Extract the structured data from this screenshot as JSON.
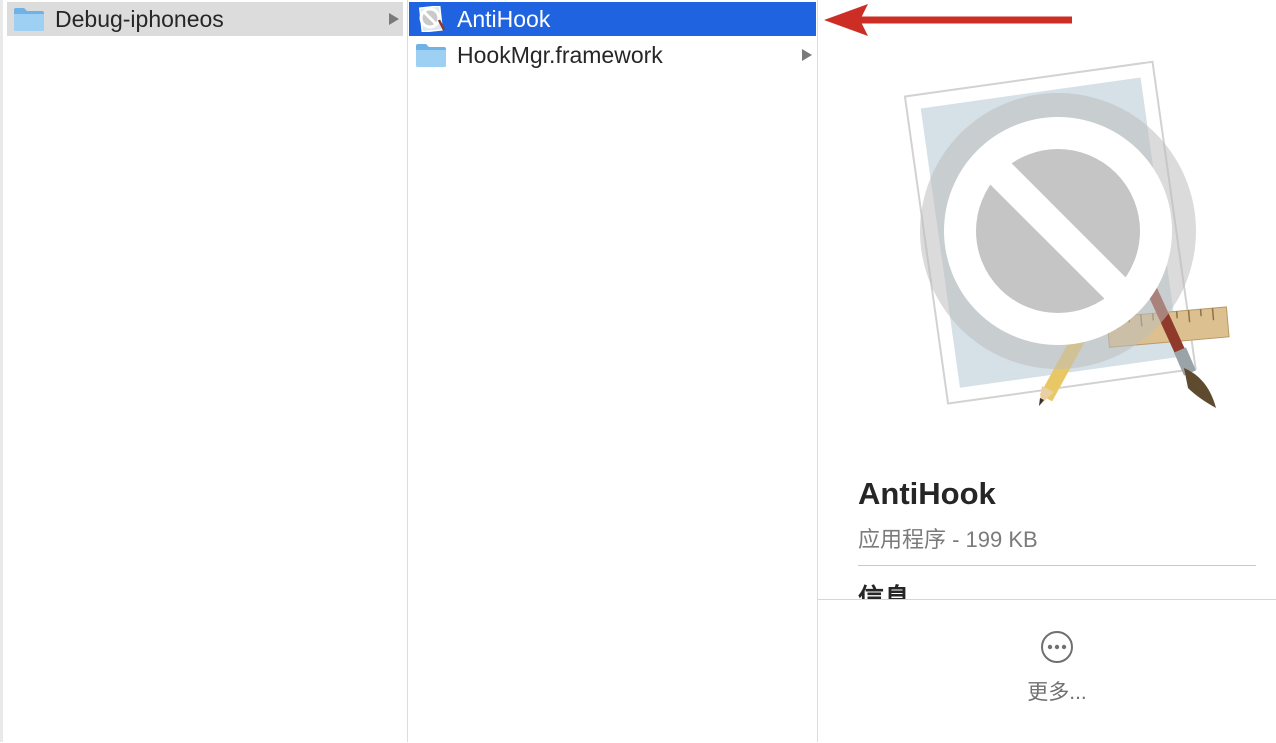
{
  "columns": [
    {
      "items": [
        {
          "label": "Debug-iphoneos",
          "icon": "folder-icon",
          "state": "parent-selected",
          "has_children": true
        }
      ]
    },
    {
      "items": [
        {
          "label": "AntiHook",
          "icon": "app-icon",
          "state": "selected",
          "has_children": false
        },
        {
          "label": "HookMgr.framework",
          "icon": "folder-icon",
          "state": "normal",
          "has_children": true
        }
      ]
    }
  ],
  "preview": {
    "name": "AntiHook",
    "kind_size": "应用程序 - 199 KB",
    "info_heading": "信息",
    "more_label": "更多...",
    "icon": "prohibited-app-icon"
  },
  "annotation": {
    "type": "arrow",
    "color": "#cc2e25",
    "points_to": "AntiHook"
  },
  "colors": {
    "selection": "#1f63e1",
    "parent_selection": "#dcdcdc",
    "folder": "#8dc6f0",
    "arrow": "#cc2e25"
  }
}
